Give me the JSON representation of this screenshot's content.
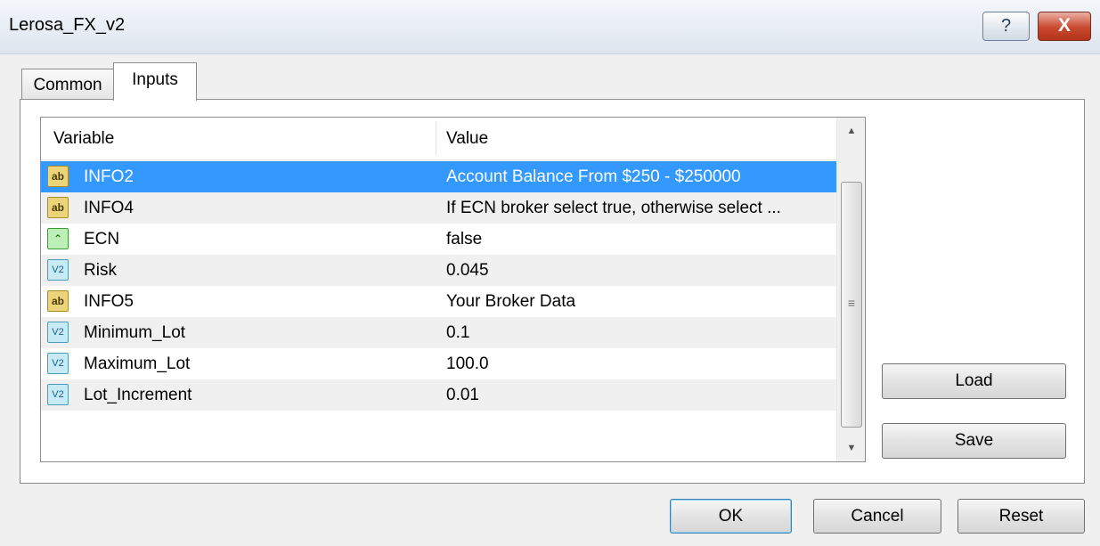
{
  "window": {
    "title": "Lerosa_FX_v2",
    "help_label": "?",
    "close_label": "X"
  },
  "tabs": [
    {
      "label": "Common"
    },
    {
      "label": "Inputs"
    }
  ],
  "table": {
    "columns": [
      "Variable",
      "Value"
    ],
    "rows": [
      {
        "variable": "INFO2",
        "value": "Account Balance From $250 - $250000",
        "icon": "string-ab-icon",
        "icon_label": "ab"
      },
      {
        "variable": "INFO4",
        "value": "If ECN broker select true, otherwise select ...",
        "icon": "string-ab-icon",
        "icon_label": "ab"
      },
      {
        "variable": "ECN",
        "value": "false",
        "icon": "boolean-icon",
        "icon_label": "⌃"
      },
      {
        "variable": "Risk",
        "value": "0.045",
        "icon": "number-v2-icon",
        "icon_label": "V2"
      },
      {
        "variable": "INFO5",
        "value": "Your Broker Data",
        "icon": "string-ab-icon",
        "icon_label": "ab"
      },
      {
        "variable": "Minimum_Lot",
        "value": "0.1",
        "icon": "number-v2-icon",
        "icon_label": "V2"
      },
      {
        "variable": "Maximum_Lot",
        "value": "100.0",
        "icon": "number-v2-icon",
        "icon_label": "V2"
      },
      {
        "variable": "Lot_Increment",
        "value": "0.01",
        "icon": "number-v2-icon",
        "icon_label": "V2"
      }
    ],
    "selected_row": 0
  },
  "buttons": {
    "load": "Load",
    "save": "Save",
    "ok": "OK",
    "cancel": "Cancel",
    "reset": "Reset"
  },
  "colors": {
    "selection": "#3399ff",
    "alt_row": "#f0f0f0",
    "close_button": "#c9482f"
  }
}
